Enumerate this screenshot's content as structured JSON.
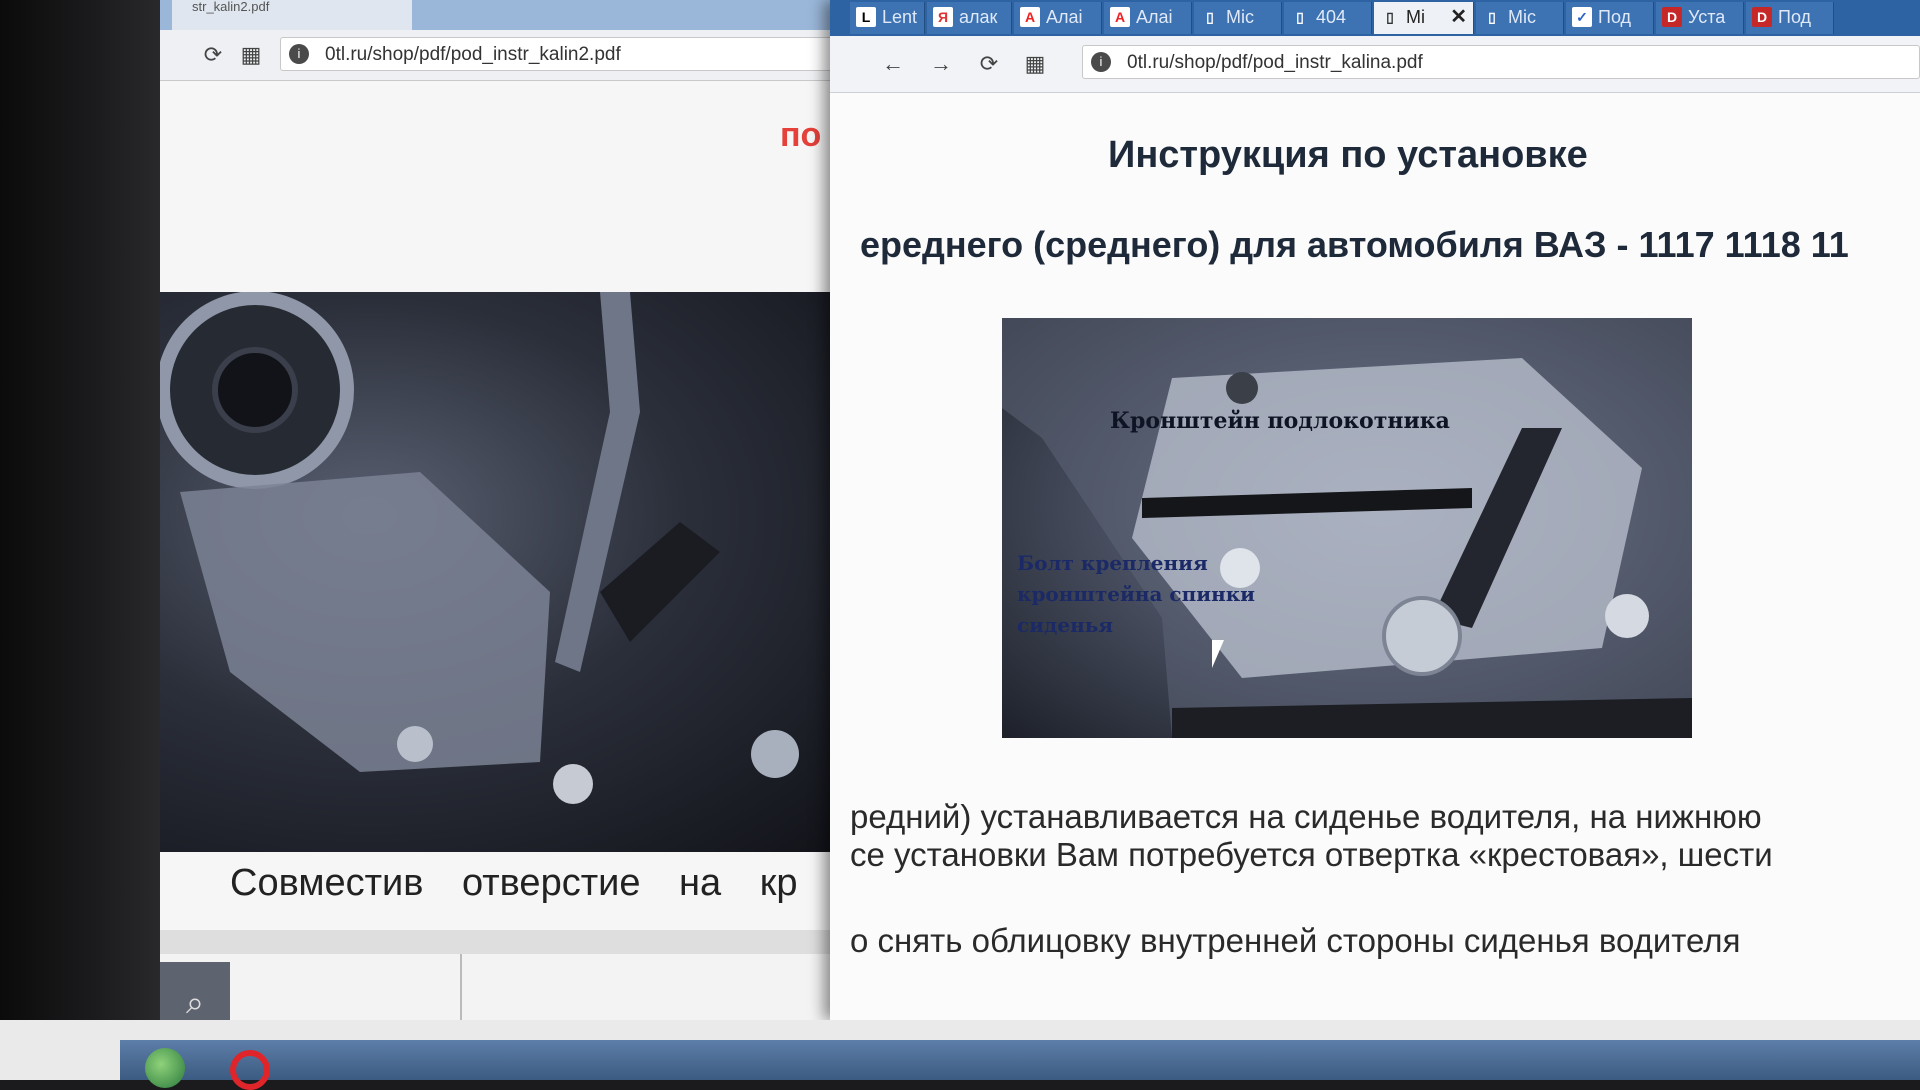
{
  "back_window": {
    "tab_title": "str_kalin2.pdf",
    "url": "0tl.ru/shop/pdf/pod_instr_kalin2.pdf",
    "heading_fragment": "по у",
    "caption": "Совместив отверстие на кр"
  },
  "front_window": {
    "tabs": [
      {
        "icon": "L",
        "label": "Lent"
      },
      {
        "icon": "Я",
        "label": "алак"
      },
      {
        "icon": "A",
        "label": "Алаі"
      },
      {
        "icon": "A",
        "label": "Алаі"
      },
      {
        "icon": "▯",
        "label": "Mic"
      },
      {
        "icon": "▯",
        "label": "404"
      },
      {
        "icon": "▯",
        "label": "Mi",
        "active": true
      },
      {
        "icon": "▯",
        "label": "Mic"
      },
      {
        "icon": "✓",
        "label": "Под"
      },
      {
        "icon": "D",
        "label": "Уста"
      },
      {
        "icon": "D",
        "label": "Под"
      }
    ],
    "url": "0tl.ru/shop/pdf/pod_instr_kalina.pdf",
    "title": "Инструкция по установке",
    "subtitle": "ереднего (среднего) для автомобиля ВАЗ - 1117 1118 11",
    "photo_labels": {
      "bracket": "Кронштейн подлокотника",
      "bolt": "Болт крепления\nкронштейна спинки\nсиденья"
    },
    "paragraph": [
      "редний) устанавливается на сиденье водителя, на нижнюю",
      "се установки Вам потребуется отвертка «крестовая», шести",
      "о снять облицовку внутренней стороны сиденья водителя"
    ]
  },
  "colors": {
    "tabstrip": "#2d63a3",
    "heading_red": "#e5403a",
    "label_blue": "#1b2a66"
  }
}
